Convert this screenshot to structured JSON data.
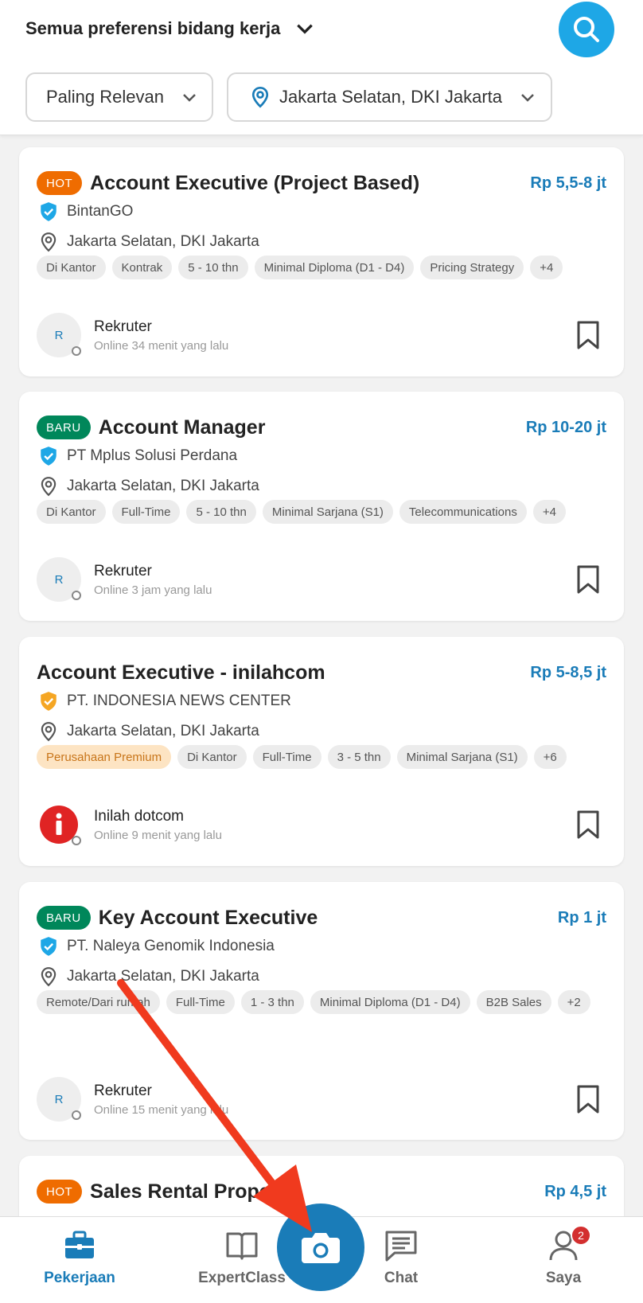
{
  "header": {
    "preference_label": "Semua preferensi bidang kerja",
    "sort_label": "Paling Relevan",
    "location_label": "Jakarta Selatan, DKI Jakarta"
  },
  "jobs": [
    {
      "badge": "HOT",
      "title": "Account Executive (Project Based)",
      "salary": "Rp 5,5-8 jt",
      "company": "BintanGO",
      "location": "Jakarta Selatan, DKI Jakarta",
      "tags": [
        "Di Kantor",
        "Kontrak",
        "5 - 10 thn",
        "Minimal Diploma (D1 - D4)",
        "Pricing Strategy",
        "+4"
      ],
      "recruiter_initial": "R",
      "recruiter_name": "Rekruter",
      "online": "Online 34 menit yang lalu"
    },
    {
      "badge": "BARU",
      "title": "Account Manager",
      "salary": "Rp 10-20 jt",
      "company": "PT Mplus Solusi Perdana",
      "location": "Jakarta Selatan, DKI Jakarta",
      "tags": [
        "Di Kantor",
        "Full-Time",
        "5 - 10 thn",
        "Minimal Sarjana (S1)",
        "Telecommunications",
        "+4"
      ],
      "recruiter_initial": "R",
      "recruiter_name": "Rekruter",
      "online": "Online 3 jam yang lalu"
    },
    {
      "badge": "",
      "title": "Account Executive - inilahcom",
      "salary": "Rp 5-8,5 jt",
      "company": "PT. INDONESIA NEWS CENTER",
      "location": "Jakarta Selatan, DKI Jakarta",
      "tags": [
        "Perusahaan Premium",
        "Di Kantor",
        "Full-Time",
        "3 - 5 thn",
        "Minimal Sarjana (S1)",
        "+6"
      ],
      "recruiter_initial": "",
      "recruiter_name": "Inilah dotcom",
      "online": "Online 9 menit yang lalu"
    },
    {
      "badge": "BARU",
      "title": "Key Account Executive",
      "salary": "Rp 1 jt",
      "company": "PT. Naleya Genomik Indonesia",
      "location": "Jakarta Selatan, DKI Jakarta",
      "tags": [
        "Remote/Dari rumah",
        "Full-Time",
        "1 - 3 thn",
        "Minimal Diploma (D1 - D4)",
        "B2B Sales",
        "+2"
      ],
      "recruiter_initial": "R",
      "recruiter_name": "Rekruter",
      "online": "Online 15 menit yang lalu"
    },
    {
      "badge": "HOT",
      "title": "Sales Rental Propert",
      "salary": "Rp 4,5 jt"
    }
  ],
  "nav": {
    "items": [
      "Pekerjaan",
      "ExpertClass",
      "Chat",
      "Saya"
    ],
    "active": "Pekerjaan",
    "notification_count": "2"
  },
  "colors": {
    "accent": "#1a7cb8",
    "search_button": "#1ea7e6",
    "hot_badge": "#ef6c00",
    "new_badge": "#00875a",
    "arrow": "#f03a1e"
  }
}
